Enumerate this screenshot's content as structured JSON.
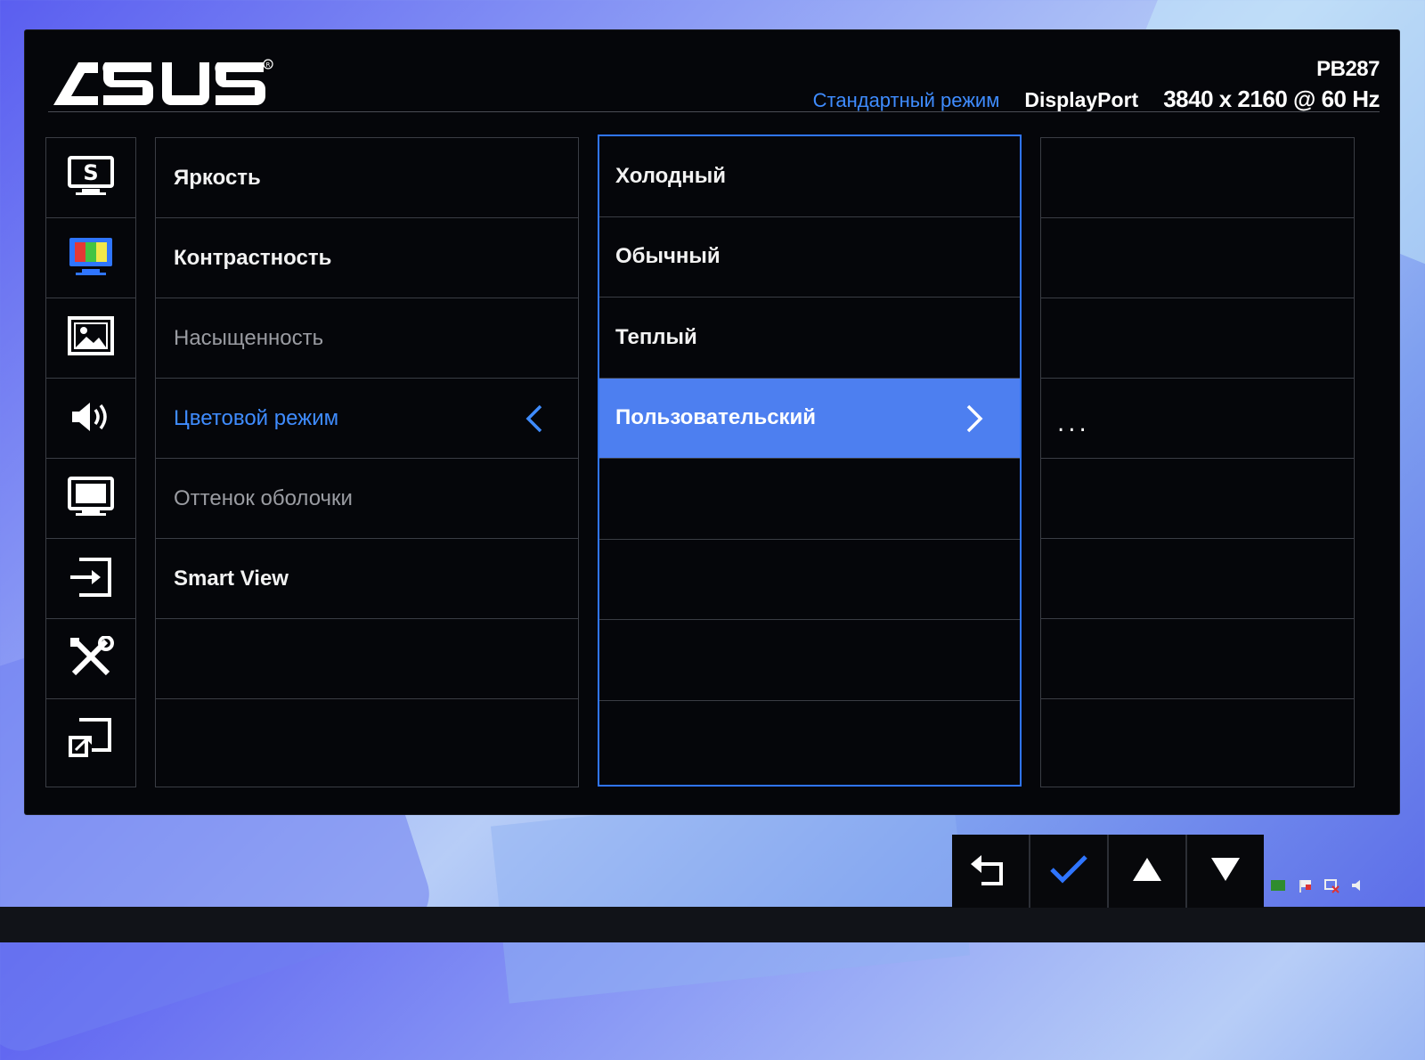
{
  "header": {
    "brand": "ASUS",
    "model": "PB287",
    "preset_mode": "Стандартный режим",
    "input_port": "DisplayPort",
    "resolution": "3840 x 2160 @ 60 Hz"
  },
  "sidebar": {
    "items": [
      {
        "icon": "splendid-s-icon"
      },
      {
        "icon": "color-monitor-icon",
        "active": true
      },
      {
        "icon": "image-icon"
      },
      {
        "icon": "speaker-icon"
      },
      {
        "icon": "monitor-icon"
      },
      {
        "icon": "input-select-icon"
      },
      {
        "icon": "tools-icon"
      },
      {
        "icon": "shortcut-icon"
      }
    ]
  },
  "main_menu": {
    "items": [
      {
        "label": "Яркость",
        "state": "normal"
      },
      {
        "label": "Контрастность",
        "state": "normal"
      },
      {
        "label": "Насыщенность",
        "state": "disabled"
      },
      {
        "label": "Цветовой режим",
        "state": "active"
      },
      {
        "label": "Оттенок оболочки",
        "state": "disabled"
      },
      {
        "label": "Smart View",
        "state": "normal"
      },
      {
        "label": "",
        "state": "empty"
      },
      {
        "label": "",
        "state": "empty"
      }
    ]
  },
  "submenu": {
    "items": [
      {
        "label": "Холодный"
      },
      {
        "label": "Обычный"
      },
      {
        "label": "Теплый"
      },
      {
        "label": "Пользовательский",
        "selected": true
      },
      {
        "label": ""
      },
      {
        "label": ""
      },
      {
        "label": ""
      },
      {
        "label": ""
      }
    ]
  },
  "third_column": {
    "ellipsis": "..."
  },
  "nav_buttons": [
    {
      "icon": "back-icon"
    },
    {
      "icon": "check-icon"
    },
    {
      "icon": "up-arrow-icon"
    },
    {
      "icon": "down-arrow-icon"
    }
  ],
  "colors": {
    "accent": "#3f8cff",
    "selection": "#4d7ff0",
    "osd_bg": "#05060a"
  }
}
